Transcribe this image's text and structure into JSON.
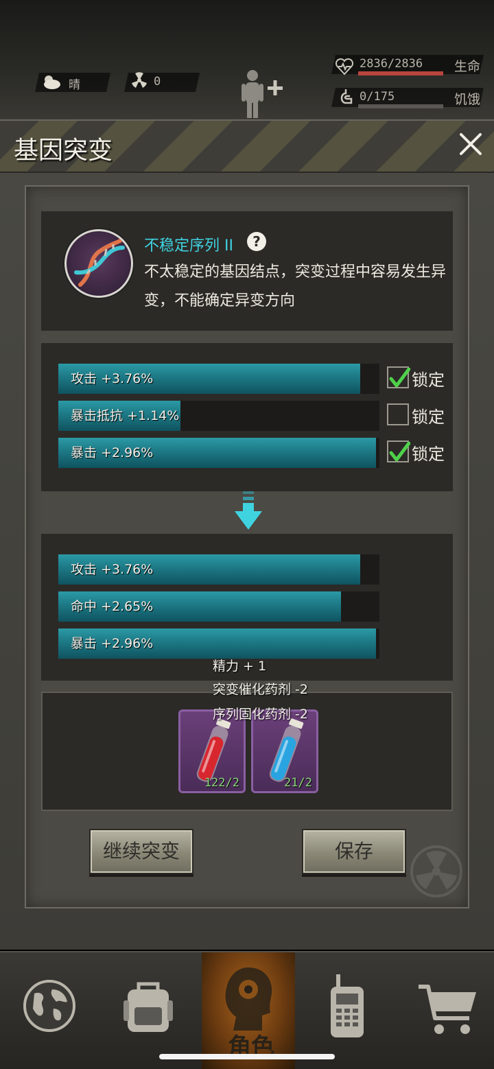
{
  "hud": {
    "weather": "晴",
    "radiation": "0",
    "health": "2836/2836",
    "health_label": "生命",
    "health_fraction": 1.0,
    "hunger": "0/175",
    "hunger_label": "饥饿",
    "hunger_fraction": 0.0
  },
  "dialog": {
    "title": "基因突变"
  },
  "gene": {
    "name": "不稳定序列",
    "name_suffix": "II",
    "description": "不太稳定的基因结点，突变过程中容易发生异变，不能确定异变方向"
  },
  "current_stats": [
    {
      "label": "攻击 +3.76%",
      "fill": 0.94,
      "locked": true
    },
    {
      "label": "暴击抵抗 +1.14%",
      "fill": 0.38,
      "locked": false
    },
    {
      "label": "暴击 +2.96%",
      "fill": 0.99,
      "locked": true
    }
  ],
  "lock_label": "锁定",
  "new_stats": [
    {
      "label": "攻击 +3.76%",
      "fill": 0.94
    },
    {
      "label": "命中 +2.65%",
      "fill": 0.88
    },
    {
      "label": "暴击 +2.96%",
      "fill": 0.99
    }
  ],
  "costs": {
    "energy": "精力 + 1",
    "catalyst": "突变催化药剂 -2",
    "fixative": "序列固化药剂 -2"
  },
  "potions": [
    {
      "name": "red-potion",
      "count": "122/2",
      "color": "#d8262f"
    },
    {
      "name": "blue-potion",
      "count": "21/2",
      "color": "#2aa4e0"
    }
  ],
  "buttons": {
    "continue": "继续突变",
    "save": "保存"
  },
  "nav": {
    "role_label": "角色"
  },
  "colors": {
    "accent": "#3fd3e0",
    "stat_bar": "#1e7c88",
    "health_bar": "#b8453e",
    "potion_frame": "#8a5fa2"
  }
}
